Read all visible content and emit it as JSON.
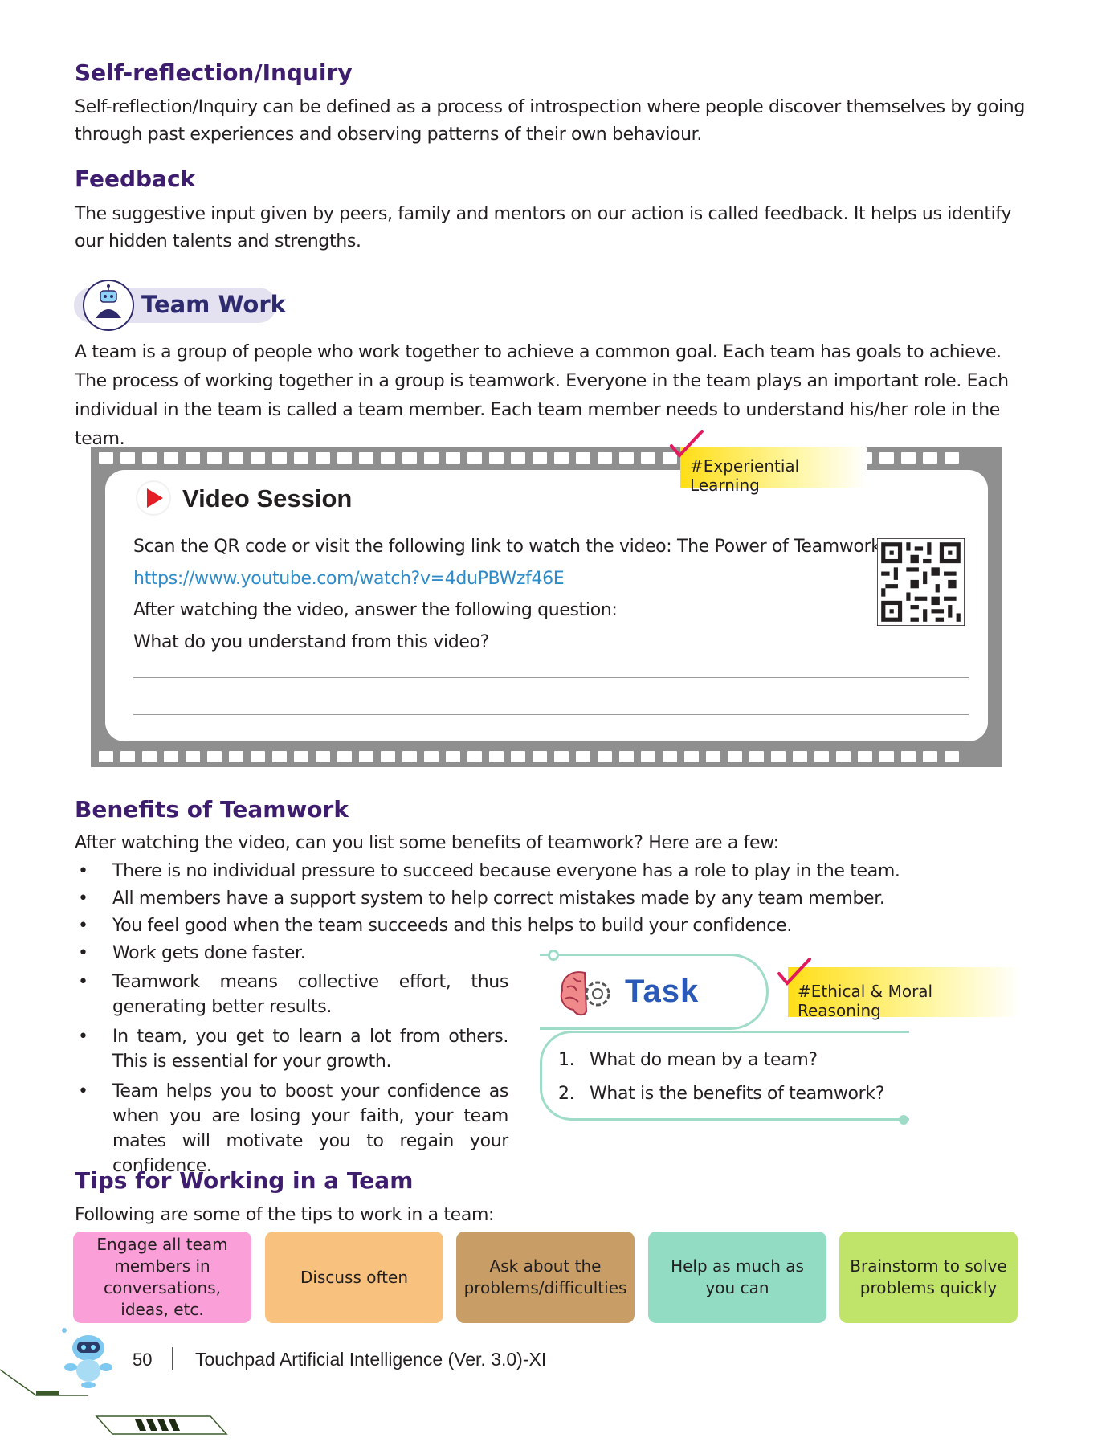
{
  "self_reflection": {
    "heading": "Self-reflection/Inquiry",
    "text": "Self-reflection/Inquiry can be defined as a process of introspection where people discover themselves by going through past experiences and observing patterns of their own behaviour."
  },
  "feedback": {
    "heading": "Feedback",
    "text": "The suggestive input given by peers, family and mentors on our action is called feedback. It helps us identify our hidden talents and strengths."
  },
  "team_work": {
    "label": "Team Work",
    "text": "A team is a group of people who work together to achieve a common goal. Each team has goals to achieve. The process of working together in a group is teamwork. Everyone in the team plays an important role. Each individual in the team is called a team member. Each team member needs to understand his/her role in the team."
  },
  "video_session": {
    "tag": "#Experiential Learning",
    "title": "Video Session",
    "line1": "Scan the QR code or visit the following link to watch the video: The Power of Teamwork",
    "link": "https://www.youtube.com/watch?v=4duPBWzf46E",
    "line2": "After watching the video, answer the following question:",
    "question": "What do you understand from this video?"
  },
  "benefits": {
    "heading": "Benefits of Teamwork",
    "intro": "After watching the video, can you list some benefits of teamwork? Here are a few:",
    "items": [
      "There is no individual pressure to succeed because everyone has a role to play in the team.",
      "All members have a support system to help correct mistakes made by any team member.",
      "You feel good when the team succeeds and this helps to build your confidence.",
      "Work gets done faster.",
      "Teamwork means collective effort, thus generating better results.",
      "In team, you get to learn a lot from others. This is essential for your growth.",
      "Team helps you to boost your confidence as when you are losing your faith, your team mates will motivate you to regain your confidence."
    ]
  },
  "task": {
    "title": "Task",
    "tag": "#Ethical & Moral Reasoning",
    "q1_num": "1.",
    "q1": "What do mean by a team?",
    "q2_num": "2.",
    "q2": "What is the benefits of teamwork?"
  },
  "tips": {
    "heading": "Tips for Working in a Team",
    "intro": "Following are some of the tips to work in a team:",
    "cards": [
      {
        "text": "Engage all team members in conversations, ideas, etc.",
        "color": "#fb9fd8"
      },
      {
        "text": "Discuss often",
        "color": "#f8c17d"
      },
      {
        "text": "Ask about the problems/difficulties",
        "color": "#c89d66"
      },
      {
        "text": "Help as much as you can",
        "color": "#93dcc4"
      },
      {
        "text": "Brainstorm to solve problems quickly",
        "color": "#c0e46a"
      }
    ]
  },
  "footer": {
    "page_number": "50",
    "title": "Touchpad Artificial Intelligence (Ver. 3.0)-XI"
  },
  "colors": {
    "heading": "#3f1d6e",
    "link": "#2e8bc9",
    "film": "#8f8f8f",
    "task_outline": "#9fdcc8",
    "task_title": "#2b59b8",
    "tag_yellow": "#ffde17"
  }
}
